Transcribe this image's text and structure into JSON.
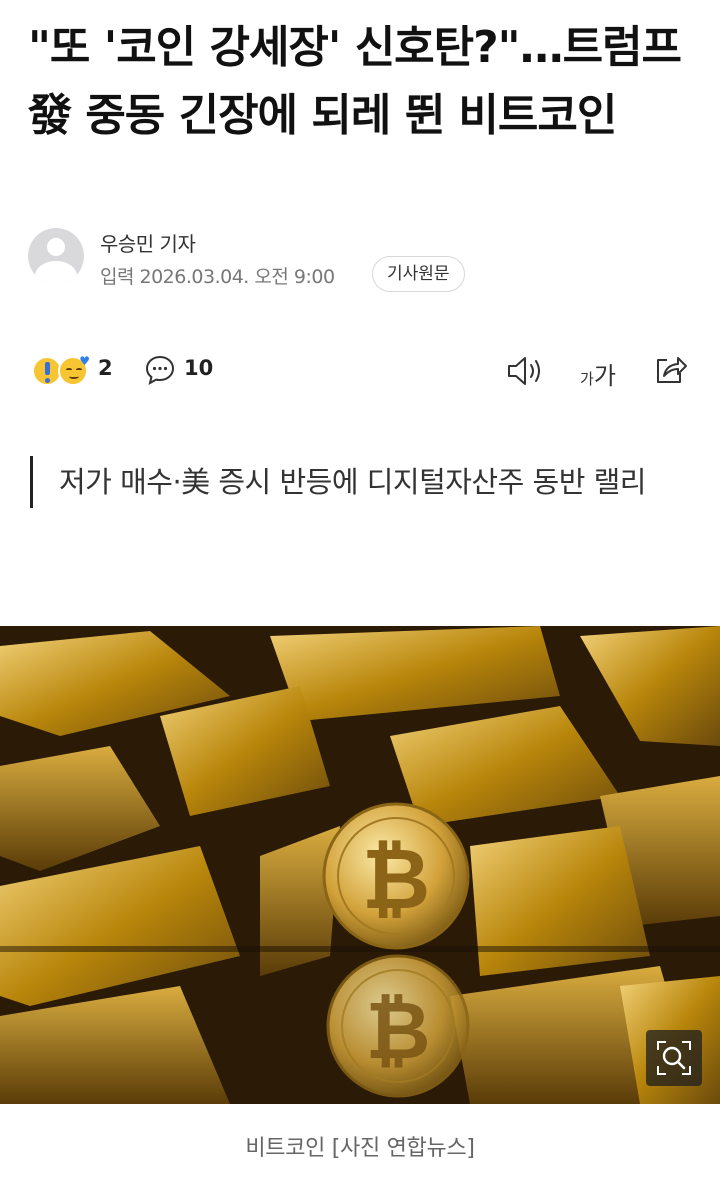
{
  "article": {
    "headline": "\"또 '코인 강세장' 신호탄?\"…트럼프發 중동 긴장에 되레 뛴 비트코인",
    "reporter": "우승민 기자",
    "timestamp": "입력 2026.03.04. 오전 9:00",
    "original_button": "기사원문",
    "summary": "저가 매수·美 증시 반등에 디지털자산주 동반 랠리",
    "photo_caption": "비트코인 [사진 연합뉴스]"
  },
  "toolbar": {
    "reaction_count": "2",
    "comment_count": "10",
    "font_size_small": "가",
    "font_size_large": "가",
    "icons": [
      "reaction-emoji-icon",
      "comment-icon",
      "speaker-icon",
      "font-size-icon",
      "share-icon",
      "zoom-icon"
    ]
  },
  "colors": {
    "text": "#111111",
    "muted": "#777777",
    "gold": "#c99a2e",
    "accent_blue": "#2f80ed"
  }
}
